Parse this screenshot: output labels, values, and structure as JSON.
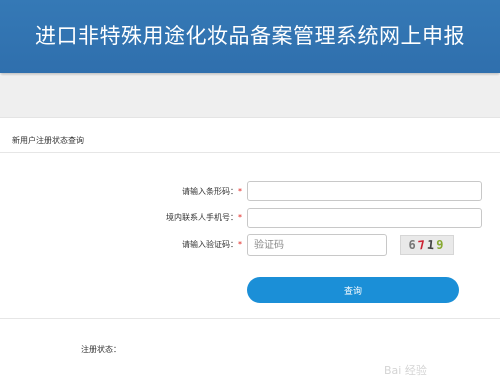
{
  "header": {
    "title": "进口非特殊用途化妆品备案管理系统网上申报"
  },
  "section": {
    "title": "新用户注册状态查询"
  },
  "form": {
    "barcode_label": "请输入条形码：",
    "phone_label": "境内联系人手机号：",
    "captcha_label": "请输入验证码：",
    "required_mark": "*",
    "captcha_placeholder": "验证码",
    "captcha_chars": [
      "6",
      "7",
      "1",
      "9"
    ],
    "submit_label": "查询"
  },
  "result": {
    "status_label": "注册状态："
  },
  "watermark": {
    "text": "Bai 经验"
  }
}
